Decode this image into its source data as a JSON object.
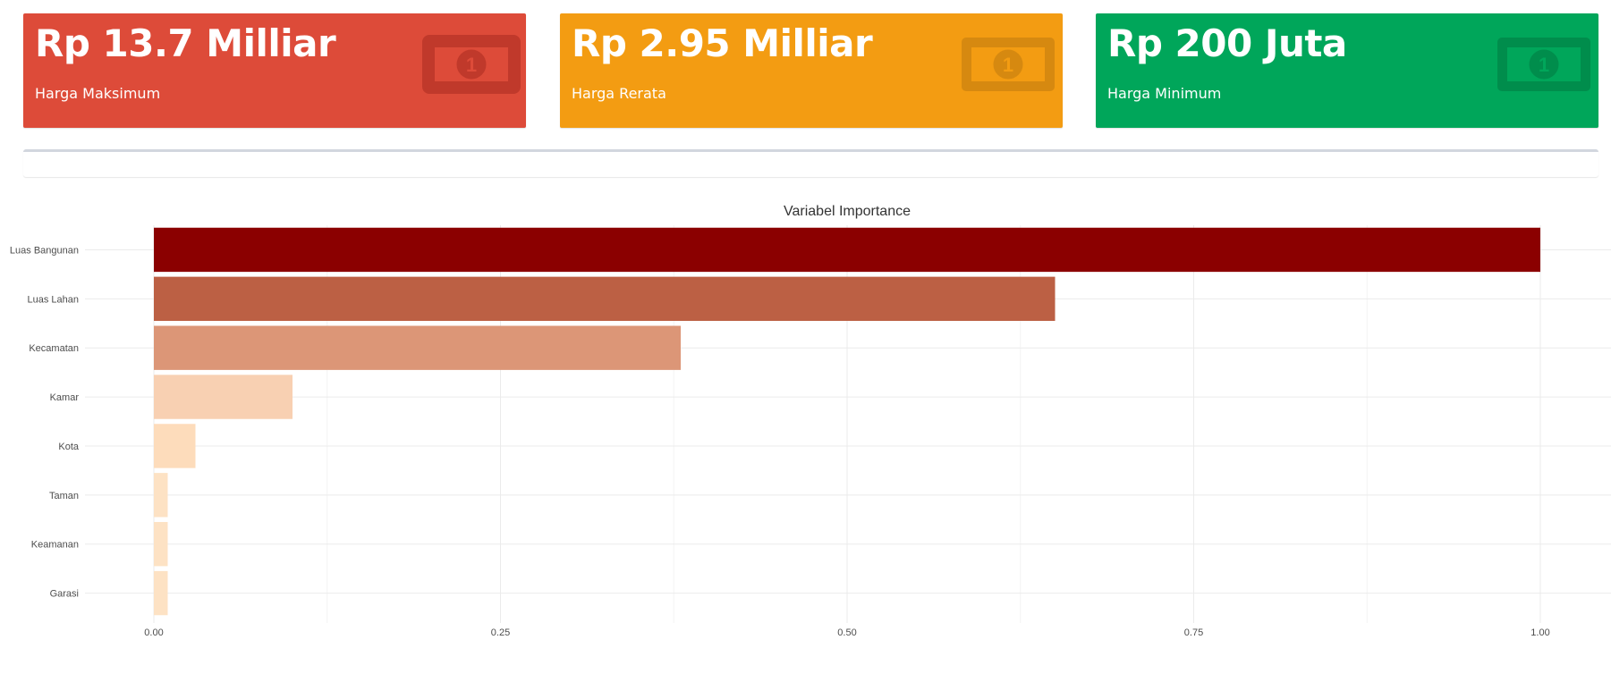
{
  "cards": [
    {
      "value": "Rp 13.7 Milliar",
      "label": "Harga Maksimum",
      "color": "#dd4b39",
      "icon_color": "#c0392b",
      "icon": "money-bill-icon"
    },
    {
      "value": "Rp 2.95 Milliar",
      "label": "Harga Rerata",
      "color": "#f39c12",
      "icon_color": "#d68910",
      "icon": "money-bill-icon"
    },
    {
      "value": "Rp 200 Juta",
      "label": "Harga Minimum",
      "color": "#00a65a",
      "icon_color": "#008d4c",
      "icon": "money-bill-icon"
    }
  ],
  "chart_data": {
    "type": "bar",
    "orientation": "horizontal",
    "title": "Variabel Importance",
    "xlabel": "",
    "ylabel": "",
    "xlim": [
      0,
      1.0
    ],
    "x_ticks": [
      "0.00",
      "0.25",
      "0.50",
      "0.75",
      "1.00"
    ],
    "categories": [
      "Luas Bangunan",
      "Luas Lahan",
      "Kecamatan",
      "Kamar",
      "Kota",
      "Taman",
      "Keamanan",
      "Garasi"
    ],
    "values": [
      1.0,
      0.65,
      0.38,
      0.1,
      0.03,
      0.01,
      0.01,
      0.01
    ],
    "colors": [
      "#8b0000",
      "#bc6044",
      "#dc9677",
      "#f8d0b2",
      "#fddcbb",
      "#fde2c4",
      "#fde2c4",
      "#fde2c4"
    ],
    "grid": true,
    "legend": "none"
  }
}
